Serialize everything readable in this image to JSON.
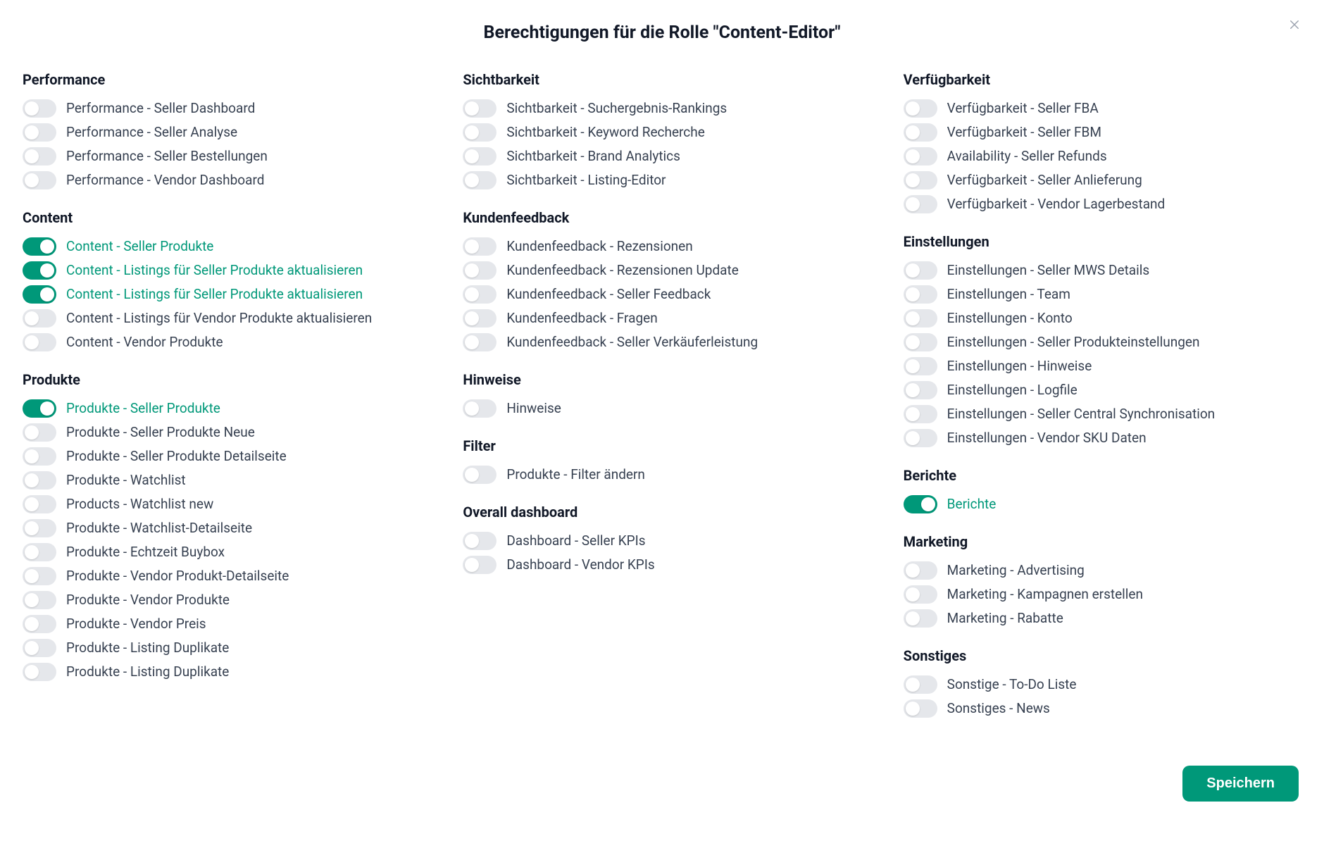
{
  "title": "Berechtigungen für die Rolle \"Content-Editor\"",
  "save_label": "Speichern",
  "columns": [
    {
      "sections": [
        {
          "title": "Performance",
          "perms": [
            {
              "label": "Performance - Seller Dashboard",
              "on": false
            },
            {
              "label": "Performance - Seller Analyse",
              "on": false
            },
            {
              "label": "Performance - Seller Bestellungen",
              "on": false
            },
            {
              "label": "Performance - Vendor Dashboard",
              "on": false
            }
          ]
        },
        {
          "title": "Content",
          "perms": [
            {
              "label": "Content - Seller Produkte",
              "on": true
            },
            {
              "label": "Content - Listings für Seller Produkte aktualisieren",
              "on": true
            },
            {
              "label": "Content - Listings für Seller Produkte aktualisieren",
              "on": true
            },
            {
              "label": "Content - Listings für Vendor Produkte aktualisieren",
              "on": false
            },
            {
              "label": "Content - Vendor Produkte",
              "on": false
            }
          ]
        },
        {
          "title": "Produkte",
          "perms": [
            {
              "label": "Produkte - Seller Produkte",
              "on": true
            },
            {
              "label": "Produkte - Seller Produkte Neue",
              "on": false
            },
            {
              "label": "Produkte - Seller Produkte Detailseite",
              "on": false
            },
            {
              "label": "Produkte - Watchlist",
              "on": false
            },
            {
              "label": "Products - Watchlist new",
              "on": false
            },
            {
              "label": "Produkte - Watchlist-Detailseite",
              "on": false
            },
            {
              "label": "Produkte - Echtzeit Buybox",
              "on": false
            },
            {
              "label": "Produkte - Vendor Produkt-Detailseite",
              "on": false
            },
            {
              "label": "Produkte - Vendor Produkte",
              "on": false
            },
            {
              "label": "Produkte - Vendor Preis",
              "on": false
            },
            {
              "label": "Produkte - Listing Duplikate",
              "on": false
            },
            {
              "label": "Produkte - Listing Duplikate",
              "on": false
            }
          ]
        }
      ]
    },
    {
      "sections": [
        {
          "title": "Sichtbarkeit",
          "perms": [
            {
              "label": "Sichtbarkeit - Suchergebnis-Rankings",
              "on": false
            },
            {
              "label": "Sichtbarkeit - Keyword Recherche",
              "on": false
            },
            {
              "label": "Sichtbarkeit - Brand Analytics",
              "on": false
            },
            {
              "label": "Sichtbarkeit - Listing-Editor",
              "on": false
            }
          ]
        },
        {
          "title": "Kundenfeedback",
          "perms": [
            {
              "label": "Kundenfeedback - Rezensionen",
              "on": false
            },
            {
              "label": "Kundenfeedback - Rezensionen Update",
              "on": false
            },
            {
              "label": "Kundenfeedback - Seller Feedback",
              "on": false
            },
            {
              "label": "Kundenfeedback - Fragen",
              "on": false
            },
            {
              "label": "Kundenfeedback - Seller Verkäuferleistung",
              "on": false
            }
          ]
        },
        {
          "title": "Hinweise",
          "perms": [
            {
              "label": "Hinweise",
              "on": false
            }
          ]
        },
        {
          "title": "Filter",
          "perms": [
            {
              "label": "Produkte - Filter ändern",
              "on": false
            }
          ]
        },
        {
          "title": "Overall dashboard",
          "perms": [
            {
              "label": "Dashboard - Seller KPIs",
              "on": false
            },
            {
              "label": "Dashboard - Vendor KPIs",
              "on": false
            }
          ]
        }
      ]
    },
    {
      "sections": [
        {
          "title": "Verfügbarkeit",
          "perms": [
            {
              "label": "Verfügbarkeit - Seller FBA",
              "on": false
            },
            {
              "label": "Verfügbarkeit - Seller FBM",
              "on": false
            },
            {
              "label": "Availability - Seller Refunds",
              "on": false
            },
            {
              "label": "Verfügbarkeit - Seller Anlieferung",
              "on": false
            },
            {
              "label": "Verfügbarkeit - Vendor Lagerbestand",
              "on": false
            }
          ]
        },
        {
          "title": "Einstellungen",
          "perms": [
            {
              "label": "Einstellungen - Seller MWS Details",
              "on": false
            },
            {
              "label": "Einstellungen - Team",
              "on": false
            },
            {
              "label": "Einstellungen - Konto",
              "on": false
            },
            {
              "label": "Einstellungen - Seller Produkteinstellungen",
              "on": false
            },
            {
              "label": "Einstellungen - Hinweise",
              "on": false
            },
            {
              "label": "Einstellungen - Logfile",
              "on": false
            },
            {
              "label": "Einstellungen - Seller Central Synchronisation",
              "on": false
            },
            {
              "label": "Einstellungen - Vendor SKU Daten",
              "on": false
            }
          ]
        },
        {
          "title": "Berichte",
          "perms": [
            {
              "label": "Berichte",
              "on": true
            }
          ]
        },
        {
          "title": "Marketing",
          "perms": [
            {
              "label": "Marketing - Advertising",
              "on": false
            },
            {
              "label": "Marketing - Kampagnen erstellen",
              "on": false
            },
            {
              "label": "Marketing - Rabatte",
              "on": false
            }
          ]
        },
        {
          "title": "Sonstiges",
          "perms": [
            {
              "label": "Sonstige - To-Do Liste",
              "on": false
            },
            {
              "label": "Sonstiges - News",
              "on": false
            }
          ]
        }
      ]
    }
  ]
}
